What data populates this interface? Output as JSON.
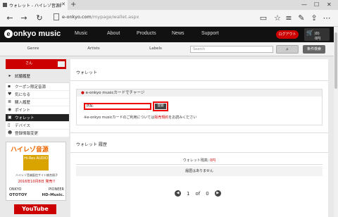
{
  "browser": {
    "tab_title": "ウォレット - ハイレゾ音源配",
    "url_domain": "e-onkyo.com",
    "url_path": "/mypage/wallet.aspx"
  },
  "site": {
    "logo_text": "onkyo music",
    "nav": [
      "Music",
      "About",
      "Products",
      "News",
      "Support"
    ],
    "login_label": "ログアウト",
    "cart_count": "(0)",
    "cart_total": "0円"
  },
  "search": {
    "genre": "Genre",
    "artists": "Artists",
    "labels": "Labels",
    "placeholder": "Search",
    "advanced": "条件検索"
  },
  "sidebar": {
    "user_name": "さん",
    "purchase_history": "試聴履歴",
    "items": [
      {
        "label": "クーポン限定音源",
        "icon": "tag-icon"
      },
      {
        "label": "気になる",
        "icon": "heart-icon"
      },
      {
        "label": "購入履歴",
        "icon": "list-icon"
      },
      {
        "label": "ポイント",
        "icon": "point-icon"
      },
      {
        "label": "ウォレット",
        "icon": "wallet-icon",
        "active": true
      },
      {
        "label": "デバイス",
        "icon": "device-icon"
      },
      {
        "label": "登録情報変更",
        "icon": "user-icon"
      }
    ],
    "banner": {
      "title": "ハイレゾ音源",
      "hires": "Hi-Res AUDIO",
      "line1": "ハイレゾ音楽配信サイト総合冊子",
      "line2": "2016年10月8日 発売!!",
      "logos_top": [
        "ONKYO",
        "PIONEER"
      ],
      "logos_bottom": [
        "OTOTOY",
        "HD-Music."
      ]
    },
    "youtube": "YouTube"
  },
  "main": {
    "wallet_title": "ウォレット",
    "charge_head": "e-onkyo musicカードでチャージ",
    "pin_label": "PIN:",
    "register_label": "登録",
    "note_prefix": "※e-onkyo musicカードのご利用については",
    "note_link": "販売規約",
    "note_suffix": "をお読みください",
    "history_title": "ウォレット 履歴",
    "balance_label": "ウォレット残高: ",
    "balance_amount": "0円",
    "no_history": "履歴はありません",
    "pager_current": "1",
    "pager_of": "of",
    "pager_total": "0"
  }
}
